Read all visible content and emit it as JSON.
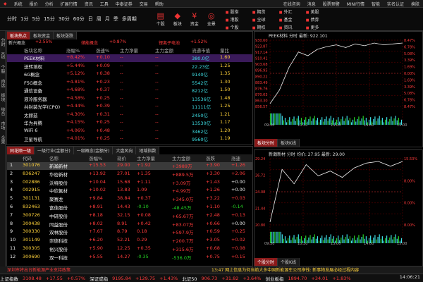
{
  "menubar": {
    "left": [
      "系统",
      "报价",
      "分析",
      "扩展行情",
      "资讯",
      "工具",
      "中泰证券",
      "交易",
      "帮助"
    ],
    "right": [
      "在线咨询",
      "消息",
      "股票预警",
      "MINI行情",
      "智能",
      "实名认证",
      "换肤"
    ]
  },
  "toolbar": {
    "periods": [
      "分时",
      "1分",
      "5分",
      "15分",
      "30分",
      "60分",
      "日",
      "周",
      "月",
      "季",
      "多周期"
    ],
    "icons": [
      {
        "label": "个股",
        "icon": "stock-icon"
      },
      {
        "label": "板块",
        "icon": "sector-icon"
      },
      {
        "label": "资金",
        "icon": "funds-icon"
      },
      {
        "label": "全景",
        "icon": "panorama-icon"
      }
    ],
    "right_menu": [
      "股指",
      "期货",
      "外汇",
      "美股",
      "港股",
      "全球",
      "基金",
      "债券",
      "个股",
      "期权",
      "资讯",
      "更多"
    ]
  },
  "sidebar": [
    "分时",
    "K线",
    "个股",
    "自选",
    "板块",
    "综合",
    "市场",
    "全景"
  ],
  "top_table": {
    "tabs": [
      "板块热点",
      "板块资金",
      "板块涨跌"
    ],
    "banner": {
      "left": "新兴概念",
      "l_val": "+2.55%",
      "mid": "储能概念",
      "m_val": "+0.87%",
      "right": "锂离子电池",
      "r_val": "+1.52%"
    },
    "headers": [
      "板块名称",
      "涨幅%",
      "涨速%",
      "主力净量",
      "主力金额",
      "流通市值",
      "量比"
    ],
    "rows": [
      [
        "PEEK材料",
        "+8.42%",
        "+0.10",
        "--",
        "--",
        "380.0亿",
        "1.60"
      ],
      [
        "送转填权",
        "+5.44%",
        "+0.09",
        "--",
        "--",
        "22.23亿",
        "1.25"
      ],
      [
        "6G概念",
        "+5.12%",
        "+0.38",
        "--",
        "--",
        "9140亿",
        "1.35"
      ],
      [
        "F5G概念",
        "+4.81%",
        "+0.23",
        "--",
        "--",
        "5542亿",
        "1.30"
      ],
      [
        "通信设备",
        "+4.68%",
        "+0.37",
        "--",
        "--",
        "8212亿",
        "1.50"
      ],
      [
        "液冷服务器",
        "+4.58%",
        "+0.25",
        "--",
        "--",
        "13536亿",
        "1.48"
      ],
      [
        "共封装光学(CPO)",
        "+4.44%",
        "+0.39",
        "--",
        "--",
        "11111亿",
        "1.25"
      ],
      [
        "太赫兹",
        "+4.30%",
        "+0.31",
        "--",
        "--",
        "2450亿",
        "1.21"
      ],
      [
        "华为昇腾",
        "+4.15%",
        "+0.25",
        "--",
        "--",
        "13530亿",
        "1.17"
      ],
      [
        "WiFi 6",
        "+4.06%",
        "+0.48",
        "--",
        "--",
        "3462亿",
        "1.20"
      ],
      [
        "卫星导航",
        "+4.01%",
        "+0.25",
        "--",
        "--",
        "9560亿",
        "1.19"
      ]
    ]
  },
  "bottom_table": {
    "tabs": [
      "同花顺一级",
      "一级行业(金额分)",
      "一级概念(金额分)",
      "大盘风向",
      "地域指数"
    ],
    "headers": [
      "代码",
      "名称",
      "涨幅%",
      "现价",
      "主力净量",
      "主力金额",
      "涨跌",
      "涨速"
    ],
    "rows": [
      [
        "1",
        "301076",
        "新瀚新材",
        "+15.53",
        "29.00",
        "+1.92",
        "+3989万",
        "+3.90",
        "+1.26"
      ],
      [
        "2",
        "836247",
        "华密新材",
        "+13.92",
        "27.01",
        "+1.35",
        "+889.5万",
        "+3.30",
        "+2.06"
      ],
      [
        "3",
        "002886",
        "沃特股份",
        "+10.04",
        "15.68",
        "+1.11",
        "+3.09万",
        "+1.43",
        "+0.00"
      ],
      [
        "4",
        "002915",
        "中欣氟材",
        "+10.02",
        "13.83",
        "1.09",
        "+4.99万",
        "+1.26",
        "+0.00"
      ],
      [
        "5",
        "301131",
        "聚赛龙",
        "+9.84",
        "38.84",
        "+0.37",
        "+345.0万",
        "+3.22",
        "+0.03"
      ],
      [
        "6",
        "832463",
        "富佳股份",
        "+8.91",
        "14.43",
        "-0.10",
        "-48.45万",
        "+1.10",
        "-0.14"
      ],
      [
        "7",
        "300726",
        "中研股份",
        "+8.18",
        "32.15",
        "+0.08",
        "+65.67万",
        "+2.48",
        "+0.13"
      ],
      [
        "8",
        "300438",
        "同益股份",
        "+8.02",
        "8.91",
        "+0.42",
        "+83.07万",
        "+0.66",
        "+0.00"
      ],
      [
        "9",
        "300330",
        "双林股份",
        "+7.67",
        "8.79",
        "0.18",
        "+597.9万",
        "+0.59",
        "+0.25"
      ],
      [
        "10",
        "301149",
        "崇德科技",
        "+6.20",
        "52.21",
        "0.29",
        "+200.7万",
        "+3.05",
        "+0.02"
      ],
      [
        "11",
        "300305",
        "裕兴股份",
        "+5.90",
        "12.25",
        "+0.35",
        "+315.6万",
        "+0.68",
        "+0.08"
      ],
      [
        "12",
        "300690",
        "双一科技",
        "+5.55",
        "14.27",
        "-0.35",
        "-536.0万",
        "+0.75",
        "+0.15"
      ]
    ]
  },
  "chart1": {
    "title": "PEEK材料 分时 最新: 922.101",
    "prices": [
      "930.60",
      "923.87",
      "917.14",
      "910.41",
      "903.68",
      "896.95",
      "890.22",
      "883.49",
      "876.76",
      "870.03",
      "863.30",
      "856.57"
    ],
    "pcts": [
      "8.47%",
      "6.78%",
      "5.08%",
      "3.39%",
      "1.69%",
      "0.00%",
      "1.69%",
      "3.39%",
      "5.08%",
      "6.78%",
      "8.47%"
    ],
    "times": [
      "09:30",
      "10:30",
      "13:00",
      "14:00",
      "15:00"
    ],
    "price_curve": [
      855,
      870,
      895,
      912,
      908,
      915,
      918,
      920,
      917,
      921,
      919,
      922,
      920,
      921,
      922
    ],
    "tabs": [
      "板块分时",
      "板块K线"
    ]
  },
  "chart2": {
    "title": "新瀚新材 分时 均价: 27.95 最新: 29.00",
    "prices": [
      "29.24",
      "26.72",
      "24.08",
      "21.44",
      "20.80"
    ],
    "pcts": [
      "15.53%",
      "8.00%",
      "0.00%",
      "8.00%"
    ],
    "times": [
      "09:30",
      "10:30",
      "13:00",
      "14:00",
      "15:00"
    ],
    "price_curve": [
      25.2,
      28.5,
      27.6,
      28.8,
      28.1,
      28.4,
      28.0,
      28.6,
      28.9,
      29.0,
      28.7,
      29.0
    ],
    "tabs": [
      "个股分时",
      "个股K线"
    ]
  },
  "news": {
    "left": "深圳市将出台新能源产业支持政策",
    "right": "13:47 网上信息为何当前大多中国新能源车公司挣钱: 新事物发展必经过程内容"
  },
  "status": [
    {
      "t": "上证指数",
      "c": "white"
    },
    {
      "t": "3108.48",
      "c": "red"
    },
    {
      "t": "+17.55",
      "c": "red"
    },
    {
      "t": "+0.57%",
      "c": "red"
    },
    {
      "t": "深证成指",
      "c": "white"
    },
    {
      "t": "9195.84",
      "c": "red"
    },
    {
      "t": "+129.75",
      "c": "red"
    },
    {
      "t": "+1.43%",
      "c": "red"
    },
    {
      "t": "北证50",
      "c": "white"
    },
    {
      "t": "906.73",
      "c": "red"
    },
    {
      "t": "+31.82",
      "c": "red"
    },
    {
      "t": "+3.64%",
      "c": "red"
    },
    {
      "t": "创业板指",
      "c": "white"
    },
    {
      "t": "1894.70",
      "c": "red"
    },
    {
      "t": "+34.01",
      "c": "red"
    },
    {
      "t": "+1.83%",
      "c": "red"
    }
  ],
  "clock": "14:06:21",
  "colors": {
    "up": "#ff3b3b",
    "down": "#24d324",
    "accent": "#8b1a1a"
  }
}
